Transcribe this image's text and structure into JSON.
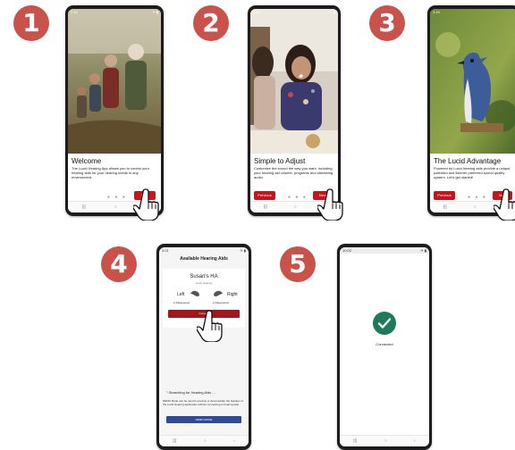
{
  "steps": [
    "1",
    "2",
    "3",
    "4",
    "5"
  ],
  "status": {
    "time": "3:15",
    "time2": "3:21",
    "time5": "10:02",
    "icons": "✈ ▮"
  },
  "nav": {
    "recents": "|||",
    "home": "○",
    "back": "‹"
  },
  "screen1": {
    "title": "Welcome",
    "description": "The Lucid Hearing App allows you to control your hearing aids for your hearing needs in any environment.",
    "next": "Next"
  },
  "screen2": {
    "title": "Simple to Adjust",
    "description": "Customize the sound the way you want, including your hearing aid volume, programs and streaming audio.",
    "previous": "Previous",
    "next": "Next"
  },
  "screen3": {
    "title": "The Lucid Advantage",
    "description": "Powered by Lucid hearing aids provide a unique, patented and listener preferred sound quality system. Let's get started!",
    "previous": "Previous",
    "next": "Next"
  },
  "screen4": {
    "header": "Available Hearing Aids",
    "device_name": "Susan's HA",
    "brand": "Lucid Hearing",
    "left": "Left",
    "right": "Right",
    "left_status": "Discovered",
    "right_status": "Discovered",
    "connect": "Connect",
    "searching": "Searching for Hearing Aids ...",
    "demo_note": "DEMO Mode can be used to preview or demonstrate the features of the Lucid Hearing application without connecting to hearing aids.",
    "demo_button": "DEMO MODE"
  },
  "screen5": {
    "status": "Connected"
  },
  "colors": {
    "accent": "#c4161c",
    "step": "#c9524a",
    "success": "#1e7a5a",
    "demo": "#2f4a9a"
  }
}
